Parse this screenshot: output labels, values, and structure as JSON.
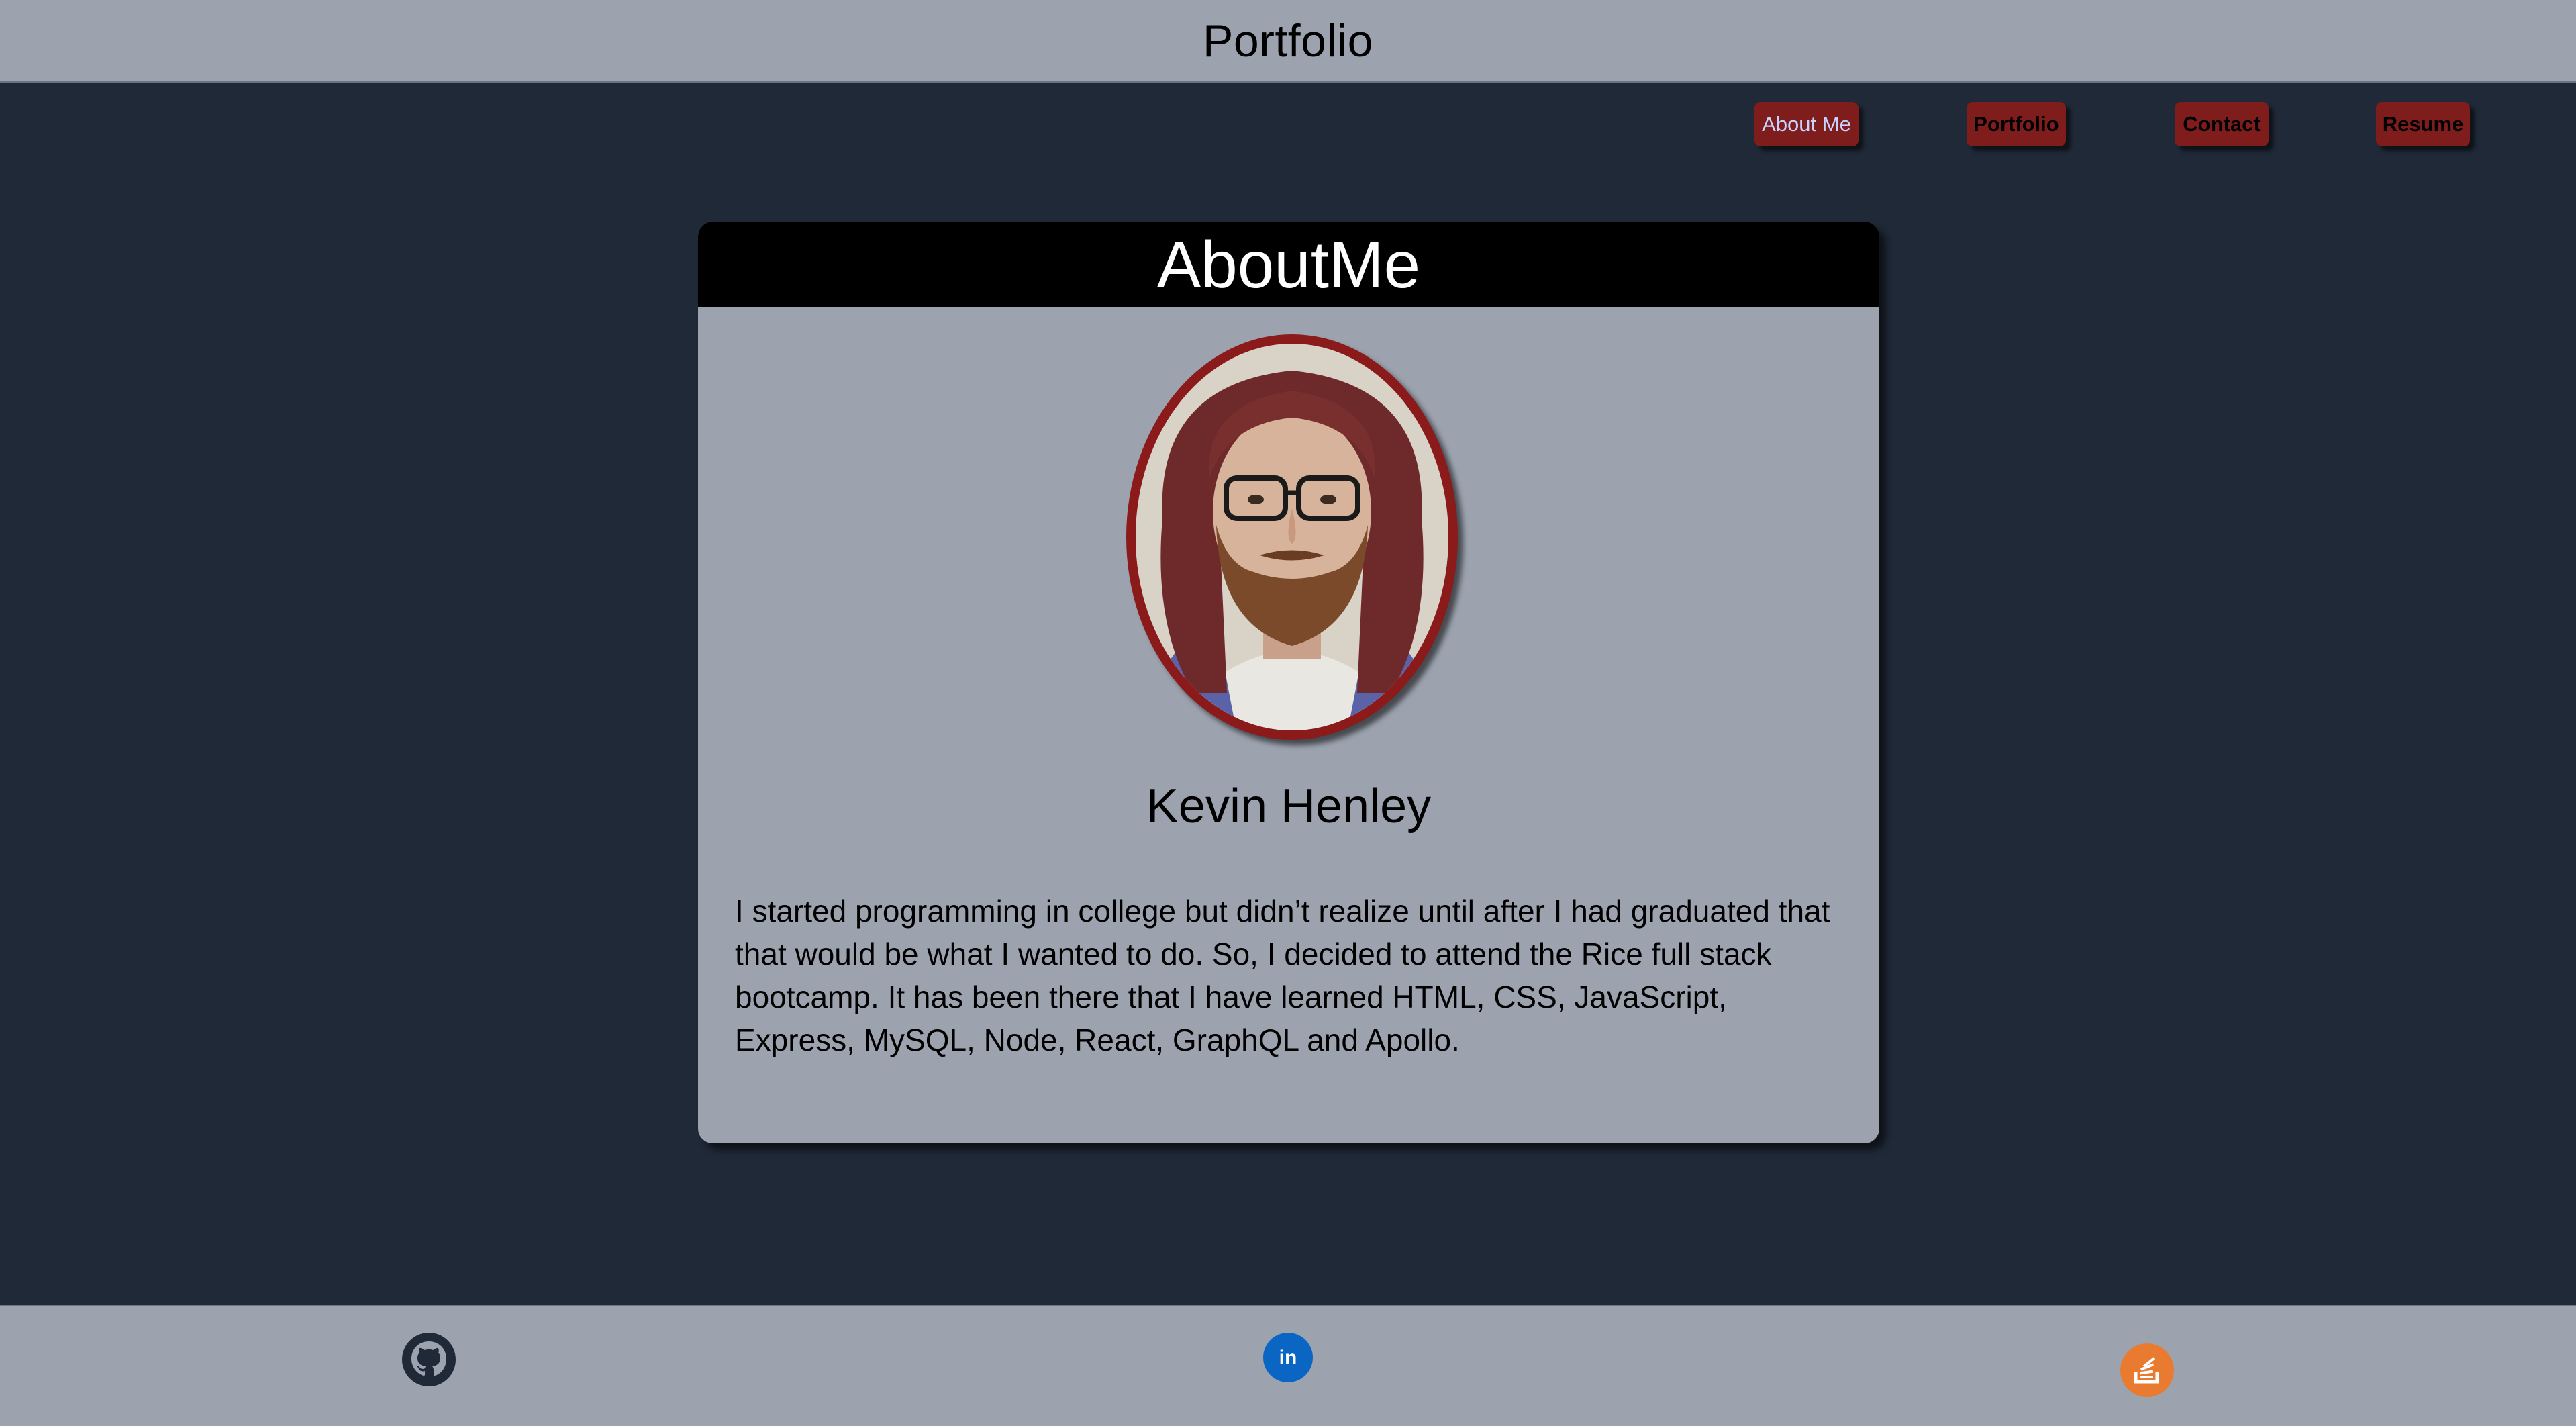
{
  "header": {
    "title": "Portfolio"
  },
  "nav": {
    "items": [
      {
        "label": "About Me",
        "active": true
      },
      {
        "label": "Portfolio",
        "active": false
      },
      {
        "label": "Contact",
        "active": false
      },
      {
        "label": "Resume",
        "active": false
      }
    ]
  },
  "about": {
    "heading": "AboutMe",
    "name": "Kevin Henley",
    "bio": "I started programming in college but didn’t realize until after I had graduated that that would be what I wanted to do. So, I decided to attend the Rice full stack bootcamp. It has been there that I have learned HTML, CSS, JavaScript, Express, MySQL, Node, React, GraphQL and Apollo.",
    "avatar_alt": "Kevin Henley"
  },
  "footer": {
    "links": [
      {
        "icon": "github-icon",
        "color": "#1f2937"
      },
      {
        "icon": "linkedin-icon",
        "color": "#0a66c2"
      },
      {
        "icon": "stackoverflow-icon",
        "color": "#e87b2f"
      }
    ]
  },
  "colors": {
    "page_bg": "#1f2937",
    "bar_bg": "#9ca3af",
    "accent_red": "#7f1d1d",
    "card_header": "#000000"
  }
}
